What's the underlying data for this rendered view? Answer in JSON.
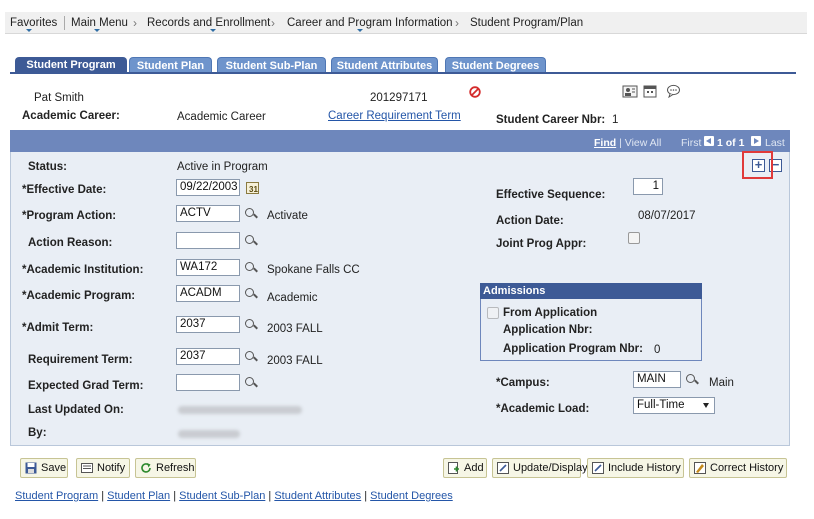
{
  "breadcrumb": {
    "favorites": "Favorites",
    "main_menu": "Main Menu",
    "records": "Records and Enrollment",
    "career": "Career and Program Information",
    "current": "Student Program/Plan"
  },
  "tabs": [
    {
      "label": "Student Program",
      "active": true
    },
    {
      "label": "Student Plan",
      "active": false
    },
    {
      "label": "Student Sub-Plan",
      "active": false
    },
    {
      "label": "Student Attributes",
      "active": false
    },
    {
      "label": "Student Degrees",
      "active": false
    }
  ],
  "header": {
    "name": "Pat Smith",
    "id": "201297171",
    "academic_career_label": "Academic Career:",
    "academic_career_value": "Academic Career",
    "career_req_term_link": "Career Requirement Term",
    "student_career_nbr_label": "Student Career Nbr:",
    "student_career_nbr_value": "1"
  },
  "nav": {
    "find": "Find",
    "view_all": "View All",
    "first": "First",
    "count": "1 of 1",
    "last": "Last"
  },
  "form": {
    "status_label": "Status:",
    "status_value": "Active in Program",
    "eff_date_label": "*Effective Date:",
    "eff_date_value": "09/22/2003",
    "prog_action_label": "*Program Action:",
    "prog_action_value": "ACTV",
    "prog_action_desc": "Activate",
    "action_reason_label": "Action Reason:",
    "action_reason_value": "",
    "acad_inst_label": "*Academic Institution:",
    "acad_inst_value": "WA172",
    "acad_inst_desc": "Spokane Falls CC",
    "acad_prog_label": "*Academic Program:",
    "acad_prog_value": "ACADM",
    "acad_prog_desc": "Academic",
    "admit_term_label": "*Admit Term:",
    "admit_term_value": "2037",
    "admit_term_desc": "2003 FALL",
    "req_term_label": "Requirement Term:",
    "req_term_value": "2037",
    "req_term_desc": "2003 FALL",
    "exp_grad_label": "Expected Grad Term:",
    "exp_grad_value": "",
    "last_updated_label": "Last Updated On:",
    "by_label": "By:",
    "eff_seq_label": "Effective Sequence:",
    "eff_seq_value": "1",
    "action_date_label": "Action Date:",
    "action_date_value": "08/07/2017",
    "joint_prog_label": "Joint Prog Appr:",
    "campus_label": "*Campus:",
    "campus_value": "MAIN",
    "campus_desc": "Main",
    "acad_load_label": "*Academic Load:",
    "acad_load_value": "Full-Time"
  },
  "admissions": {
    "title": "Admissions",
    "from_app": "From Application",
    "app_nbr_label": "Application Nbr:",
    "app_prog_nbr_label": "Application Program Nbr:",
    "app_prog_nbr_value": "0"
  },
  "buttons": {
    "save": "Save",
    "notify": "Notify",
    "refresh": "Refresh",
    "add": "Add",
    "update_display": "Update/Display",
    "include_history": "Include History",
    "correct_history": "Correct History"
  },
  "bottom_links": {
    "program": "Student Program",
    "plan": "Student Plan",
    "subplan": "Student Sub-Plan",
    "attributes": "Student Attributes",
    "degrees": "Student Degrees"
  },
  "colors": {
    "tab_active": "#3d5a96",
    "tab_inactive": "#6e94cc",
    "panel_bg": "#e9eef5",
    "highlight_red": "#e03a3a"
  }
}
